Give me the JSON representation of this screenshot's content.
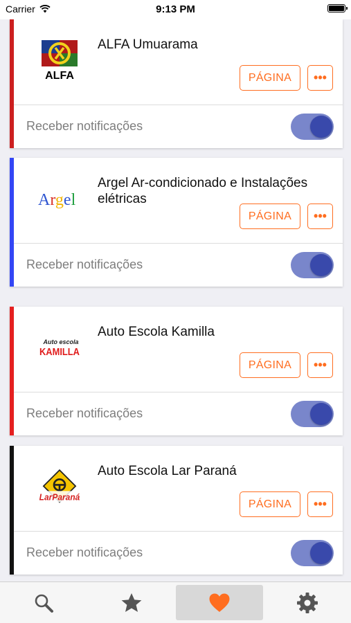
{
  "status_bar": {
    "carrier": "Carrier",
    "time": "9:13 PM",
    "battery_level": 1.0
  },
  "colors": {
    "accent": "#ff6d1f",
    "toggle_track": "#7986cb",
    "toggle_knob": "#3949ab"
  },
  "cards": [
    {
      "title": "ALFA Umuarama",
      "logo_text": "ALFA",
      "stripe_color": "#cc1f1f",
      "page_label": "PÁGINA",
      "more_label": "•••",
      "notif_label": "Receber notificações",
      "notif_on": true
    },
    {
      "title": "Argel Ar-condicionado e Instalações elétricas",
      "logo_text": "Argel",
      "stripe_color": "#3346f5",
      "page_label": "PÁGINA",
      "more_label": "•••",
      "notif_label": "Receber notificações",
      "notif_on": true
    },
    {
      "title": "Auto Escola Kamilla",
      "logo_text": "Auto escola KAMILLA",
      "stripe_color": "#e52020",
      "page_label": "PÁGINA",
      "more_label": "•••",
      "notif_label": "Receber notificações",
      "notif_on": true
    },
    {
      "title": "Auto Escola Lar Paraná",
      "logo_text": "LarParaná",
      "stripe_color": "#111111",
      "page_label": "PÁGINA",
      "more_label": "•••",
      "notif_label": "Receber notificações",
      "notif_on": true
    }
  ],
  "tab_bar": [
    {
      "icon": "search-icon",
      "active": false
    },
    {
      "icon": "star-icon",
      "active": false
    },
    {
      "icon": "heart-icon",
      "active": true
    },
    {
      "icon": "gear-icon",
      "active": false
    }
  ]
}
